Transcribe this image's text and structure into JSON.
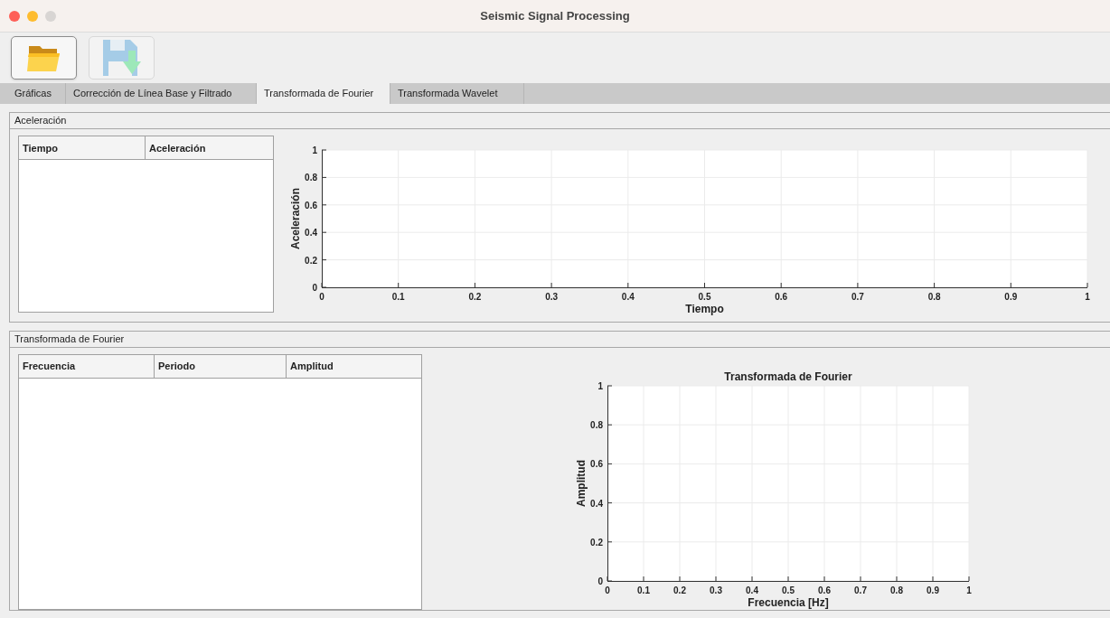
{
  "window": {
    "title": "Seismic Signal Processing"
  },
  "toolbar": [
    {
      "kind": "open",
      "disabled": false
    },
    {
      "kind": "save",
      "disabled": true
    }
  ],
  "tabs": [
    {
      "label": "Gráficas",
      "selected": false
    },
    {
      "label": "Corrección de Línea Base y Filtrado",
      "selected": false
    },
    {
      "label": "Transformada de Fourier",
      "selected": true
    },
    {
      "label": "Transformada Wavelet",
      "selected": false
    }
  ],
  "panels": [
    {
      "title": "Aceleración",
      "table": {
        "columns": [
          "Tiempo",
          "Aceleración"
        ]
      },
      "chart_data": {
        "type": "line",
        "grid": true,
        "xlabel": "Tiempo",
        "ylabel": "Aceleración",
        "xlim": [
          0,
          1
        ],
        "ylim": [
          0,
          1
        ],
        "xticks": [
          {
            "value": 0,
            "label": "0"
          },
          {
            "value": 0.1,
            "label": "0.1"
          },
          {
            "value": 0.2,
            "label": "0.2"
          },
          {
            "value": 0.3,
            "label": "0.3"
          },
          {
            "value": 0.4,
            "label": "0.4"
          },
          {
            "value": 0.5,
            "label": "0.5"
          },
          {
            "value": 0.6,
            "label": "0.6"
          },
          {
            "value": 0.7,
            "label": "0.7"
          },
          {
            "value": 0.8,
            "label": "0.8"
          },
          {
            "value": 0.9,
            "label": "0.9"
          },
          {
            "value": 1,
            "label": "1"
          }
        ],
        "yticks": [
          {
            "value": 0,
            "label": "0"
          },
          {
            "value": 0.2,
            "label": "0.2"
          },
          {
            "value": 0.4,
            "label": "0.4"
          },
          {
            "value": 0.6,
            "label": "0.6"
          },
          {
            "value": 0.8,
            "label": "0.8"
          },
          {
            "value": 1,
            "label": "1"
          }
        ]
      }
    },
    {
      "title": "Transformada de Fourier",
      "table": {
        "columns": [
          "Frecuencia",
          "Periodo",
          "Amplitud"
        ]
      },
      "chart_data": {
        "type": "line",
        "grid": true,
        "title": "Transformada de Fourier",
        "xlabel": "Frecuencia [Hz]",
        "ylabel": "Amplitud",
        "xlim": [
          0,
          1
        ],
        "ylim": [
          0,
          1
        ],
        "xticks": [
          {
            "value": 0,
            "label": "0"
          },
          {
            "value": 0.1,
            "label": "0.1"
          },
          {
            "value": 0.2,
            "label": "0.2"
          },
          {
            "value": 0.3,
            "label": "0.3"
          },
          {
            "value": 0.4,
            "label": "0.4"
          },
          {
            "value": 0.5,
            "label": "0.5"
          },
          {
            "value": 0.6,
            "label": "0.6"
          },
          {
            "value": 0.7,
            "label": "0.7"
          },
          {
            "value": 0.8,
            "label": "0.8"
          },
          {
            "value": 0.9,
            "label": "0.9"
          },
          {
            "value": 1,
            "label": "1"
          }
        ],
        "yticks": [
          {
            "value": 0,
            "label": "0"
          },
          {
            "value": 0.2,
            "label": "0.2"
          },
          {
            "value": 0.4,
            "label": "0.4"
          },
          {
            "value": 0.6,
            "label": "0.6"
          },
          {
            "value": 0.8,
            "label": "0.8"
          },
          {
            "value": 1,
            "label": "1"
          }
        ]
      }
    }
  ]
}
